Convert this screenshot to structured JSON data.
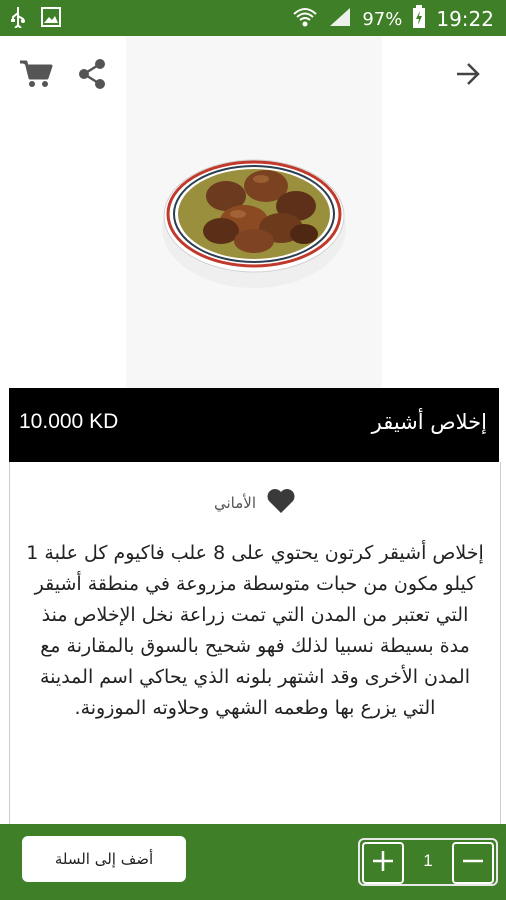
{
  "status_bar": {
    "battery_percent": "97%",
    "time": "19:22"
  },
  "header": {
    "back_icon": "arrow-right-icon",
    "share_icon": "share-icon",
    "cart_icon": "cart-icon"
  },
  "product": {
    "title": "إخلاص أشيقر",
    "price": "10.000 KD",
    "wishlist_label": "الأماني",
    "description": "إخلاص أشيقر كرتون يحتوي على 8 علب فاكيوم كل علبة 1 كيلو مكون من حبات متوسطة مزروعة في منطقة أشيقر التي تعتبر من المدن التي تمت زراعة نخل الإخلاص منذ مدة بسيطة نسبيا لذلك فهو شحيح بالسوق بالمقارنة مع المدن الأخرى وقد اشتهر بلونه الذي يحاكي اسم المدينة التي يزرع بها وطعمه الشهي وحلاوته الموزونة."
  },
  "bottom": {
    "add_to_cart_label": "أضف إلى السلة",
    "quantity": "1"
  },
  "colors": {
    "primary_green": "#3e7f27",
    "title_bar": "#000000"
  }
}
